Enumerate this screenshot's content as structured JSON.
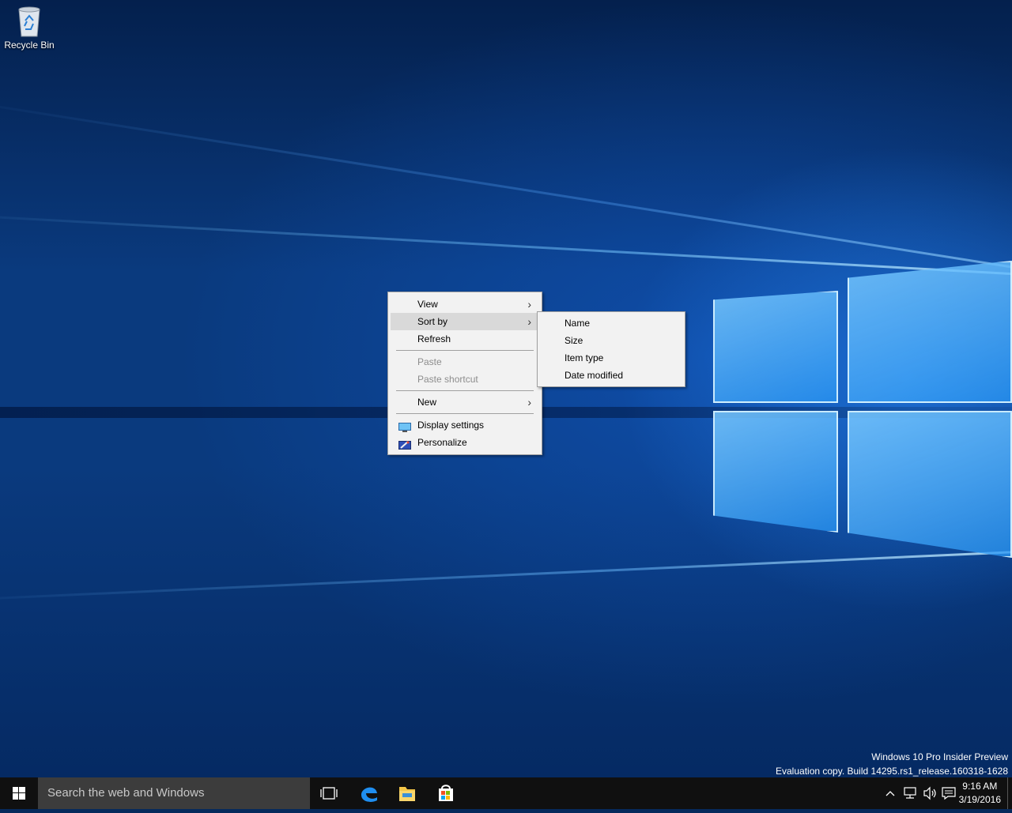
{
  "desktop": {
    "icons": [
      {
        "label": "Recycle Bin",
        "icon": "recycle-bin-icon"
      }
    ]
  },
  "context_menu": {
    "items": [
      {
        "label": "View",
        "submenu": true
      },
      {
        "label": "Sort by",
        "submenu": true,
        "selected": true
      },
      {
        "label": "Refresh"
      },
      {
        "label": "Paste",
        "disabled": true
      },
      {
        "label": "Paste shortcut",
        "disabled": true
      },
      {
        "label": "New",
        "submenu": true
      },
      {
        "label": "Display settings",
        "icon": "display-settings-icon"
      },
      {
        "label": "Personalize",
        "icon": "personalize-icon"
      }
    ]
  },
  "sort_submenu": {
    "items": [
      {
        "label": "Name"
      },
      {
        "label": "Size"
      },
      {
        "label": "Item type"
      },
      {
        "label": "Date modified"
      }
    ]
  },
  "watermark": {
    "line1": "Windows 10 Pro Insider Preview",
    "line2": "Evaluation copy. Build 14295.rs1_release.160318-1628"
  },
  "taskbar": {
    "search_placeholder": "Search the web and Windows",
    "pinned": [
      "task-view-icon",
      "edge-icon",
      "file-explorer-icon",
      "store-icon"
    ],
    "tray": [
      "chevron-up-icon",
      "network-icon",
      "volume-icon",
      "action-center-icon"
    ],
    "time": "9:16 AM",
    "date": "3/19/2016"
  },
  "colors": {
    "taskbar": "#101010",
    "search_box": "#3c3c3c",
    "menu_bg": "#f2f2f2",
    "menu_selected": "#d9d9d9"
  }
}
